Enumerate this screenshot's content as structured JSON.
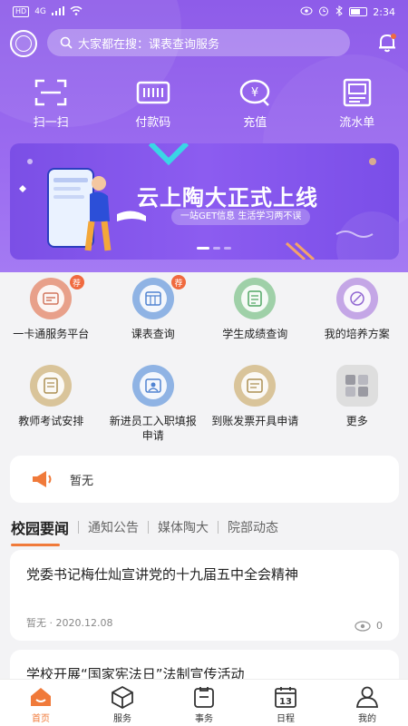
{
  "status_bar": {
    "carrier": "HD",
    "network": "4G",
    "time": "2:34"
  },
  "search": {
    "text": "大家都在搜：课表查询服务"
  },
  "quick_actions": [
    {
      "label": "扫一扫",
      "icon": "scan-icon"
    },
    {
      "label": "付款码",
      "icon": "barcode-icon"
    },
    {
      "label": "充值",
      "icon": "recharge-icon"
    },
    {
      "label": "流水单",
      "icon": "statement-icon"
    }
  ],
  "banner": {
    "title": "云上陶大正式上线",
    "subtitle": "一站GET信息 生活学习两不误"
  },
  "services_row1": [
    {
      "label": "一卡通服务平台",
      "badge": "荐",
      "color": "#e8a08a"
    },
    {
      "label": "课表查询",
      "badge": "荐",
      "color": "#8fb3e4"
    },
    {
      "label": "学生成绩查询",
      "badge": "",
      "color": "#9fd0a8"
    },
    {
      "label": "我的培养方案",
      "badge": "",
      "color": "#c4a6e6"
    }
  ],
  "services_row2": [
    {
      "label": "教师考试安排",
      "badge": "",
      "color": "#d9c49a"
    },
    {
      "label": "新进员工入职填报申请",
      "badge": "",
      "color": "#8fb3e4"
    },
    {
      "label": "到账发票开具申请",
      "badge": "",
      "color": "#d9c49a"
    },
    {
      "label": "更多",
      "badge": "",
      "color": "#dedede"
    }
  ],
  "notice": {
    "text": "暂无"
  },
  "tabs": [
    "校园要闻",
    "通知公告",
    "媒体陶大",
    "院部动态"
  ],
  "news": [
    {
      "title": "党委书记梅仕灿宣讲党的十九届五中全会精神",
      "author": "暂无",
      "date": "2020.12.08",
      "views": "0"
    },
    {
      "title": "学校开展“国家宪法日”法制宣传活动"
    }
  ],
  "bottom_nav": [
    {
      "label": "首页",
      "active": true
    },
    {
      "label": "服务",
      "active": false
    },
    {
      "label": "事务",
      "active": false
    },
    {
      "label": "日程",
      "active": false,
      "icon_text": "13"
    },
    {
      "label": "我的",
      "active": false
    }
  ],
  "colors": {
    "primary": "#8e5ce9",
    "accent": "#f07a3a"
  }
}
